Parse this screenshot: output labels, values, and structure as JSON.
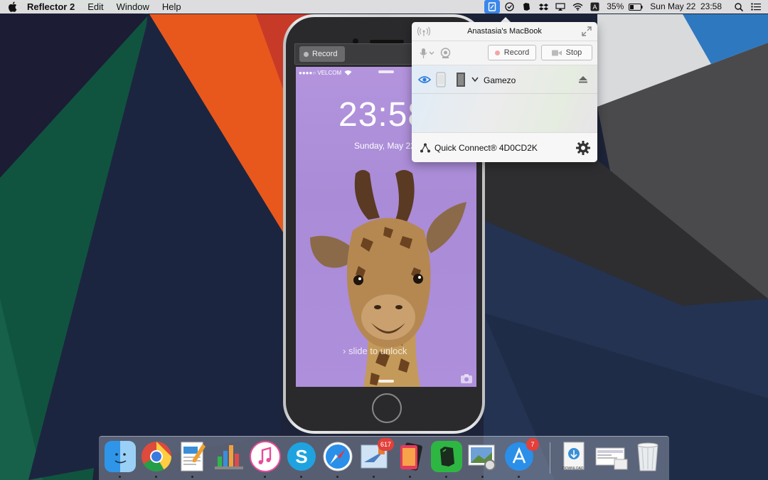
{
  "menubar": {
    "app_name": "Reflector 2",
    "menus": [
      "Edit",
      "Window",
      "Help"
    ],
    "battery": "35%",
    "datetime": "Sun May 22  23:58"
  },
  "phone": {
    "record_label": "Record",
    "carrier": "●●●●○ VELCOM",
    "clock": "23:58",
    "date": "Sunday, May 22",
    "slide_text": "› slide to unlock"
  },
  "popover": {
    "title": "Anastasia's MacBook",
    "record_label": "Record",
    "stop_label": "Stop",
    "device_name": "Gamezo",
    "quick_connect": "Quick Connect® 4D0CD2K"
  },
  "dock": {
    "items": [
      {
        "name": "finder",
        "badge": ""
      },
      {
        "name": "chrome",
        "badge": ""
      },
      {
        "name": "pages",
        "badge": ""
      },
      {
        "name": "numbers",
        "badge": ""
      },
      {
        "name": "itunes",
        "badge": ""
      },
      {
        "name": "skype",
        "badge": ""
      },
      {
        "name": "safari",
        "badge": ""
      },
      {
        "name": "mail",
        "badge": "617"
      },
      {
        "name": "reflector",
        "badge": ""
      },
      {
        "name": "evernote",
        "badge": ""
      },
      {
        "name": "preview",
        "badge": ""
      },
      {
        "name": "app-store",
        "badge": "7"
      },
      {
        "name": "downloads",
        "badge": ""
      },
      {
        "name": "screenshots-stack",
        "badge": ""
      },
      {
        "name": "trash",
        "badge": ""
      }
    ],
    "download_label": "DOWNLOAD"
  }
}
